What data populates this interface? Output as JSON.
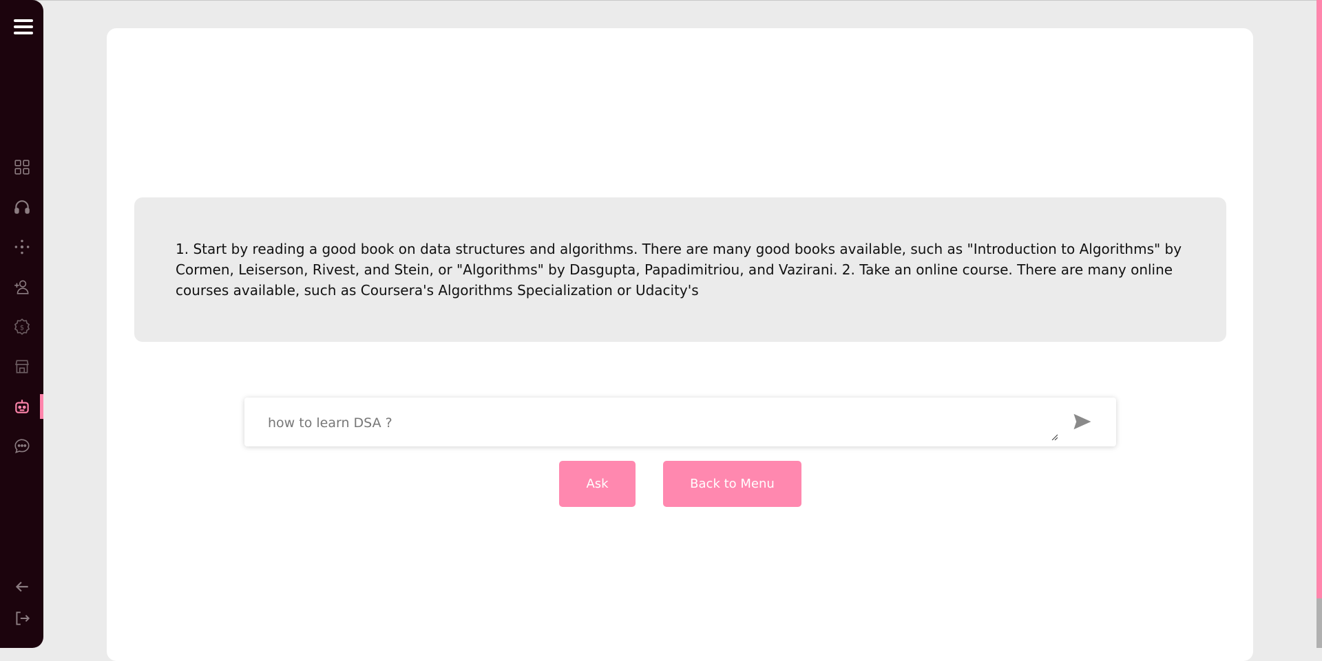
{
  "sidebar": {
    "menu_icon": "hamburger-menu-icon",
    "items": [
      {
        "icon": "dashboard-grid-icon",
        "active": false
      },
      {
        "icon": "headphones-icon",
        "active": false
      },
      {
        "icon": "dots-cross-icon",
        "active": false
      },
      {
        "icon": "add-user-icon",
        "active": false
      },
      {
        "icon": "settings-dollar-icon",
        "active": false
      },
      {
        "icon": "store-icon",
        "active": false
      },
      {
        "icon": "robot-icon",
        "active": true
      },
      {
        "icon": "chat-bubble-icon",
        "active": false
      }
    ],
    "bottom_items": [
      {
        "icon": "arrow-left-icon"
      },
      {
        "icon": "logout-icon"
      }
    ],
    "colors": {
      "background": "#1c040d",
      "active_accent": "#ff85ac",
      "icon": "#8c7d82"
    }
  },
  "answer": {
    "text": "1. Start by reading a good book on data structures and algorithms. There are many good books available, such as \"Introduction to Algorithms\" by Cormen, Leiserson, Rivest, and Stein, or \"Algorithms\" by Dasgupta, Papadimitriou, and Vazirani. 2. Take an online course. There are many online courses available, such as Coursera's Algorithms Specialization or Udacity's"
  },
  "input": {
    "value": "how to learn DSA ?",
    "send_icon": "send-icon"
  },
  "buttons": {
    "ask_label": "Ask",
    "back_label": "Back to Menu"
  },
  "theme": {
    "page_bg": "#ebebeb",
    "panel_bg": "#ffffff",
    "button_color": "#ff88af"
  }
}
